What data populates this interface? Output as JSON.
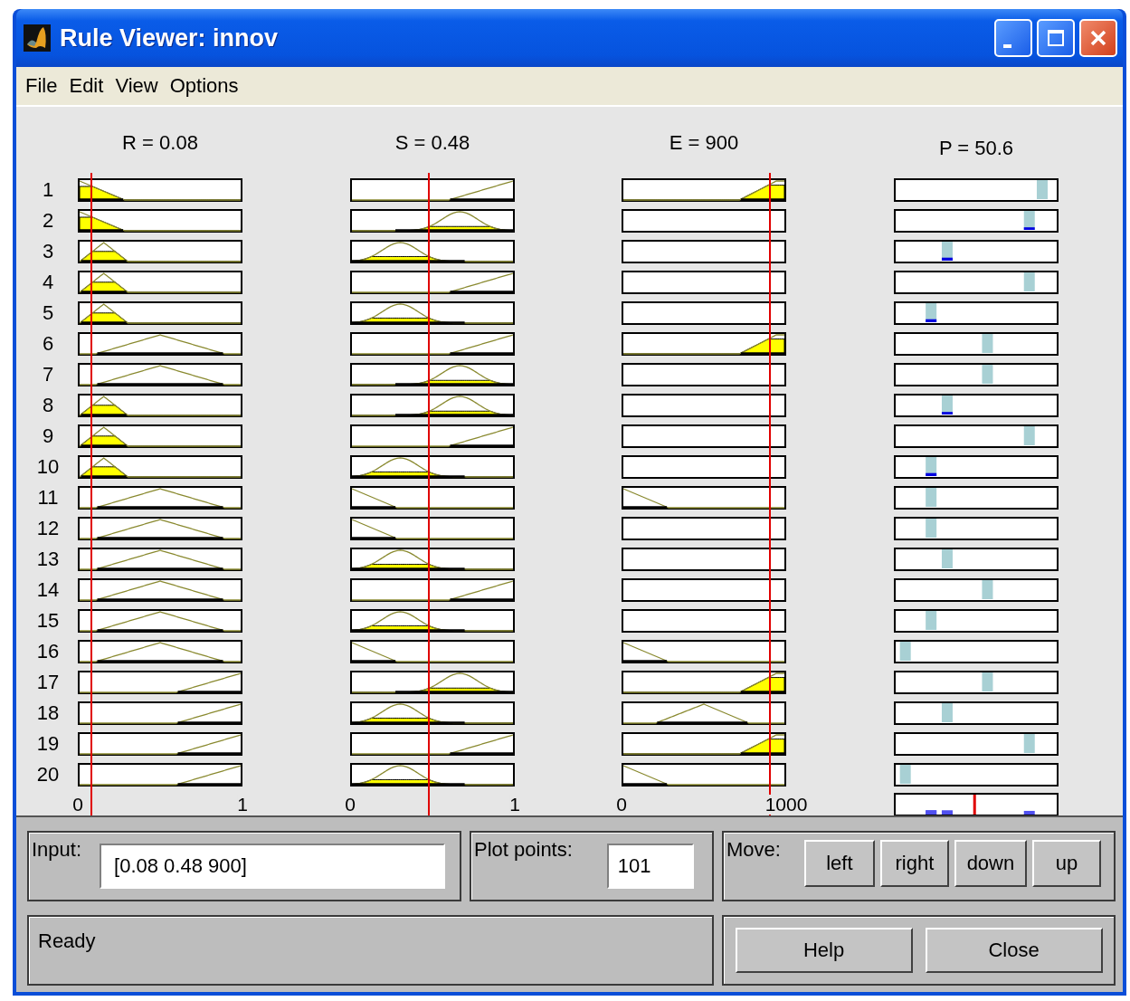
{
  "window": {
    "title": "Rule Viewer: innov"
  },
  "menu": [
    "File",
    "Edit",
    "View",
    "Options"
  ],
  "inputs": [
    {
      "label": "R = 0.08",
      "ticks": [
        "0",
        "1"
      ]
    },
    {
      "label": "S = 0.48",
      "ticks": [
        "0",
        "1"
      ]
    },
    {
      "label": "E = 900",
      "ticks": [
        "0",
        "1000"
      ]
    }
  ],
  "output": {
    "label": "P = 50.6",
    "aggregate": {
      "level": 0.49
    }
  },
  "rules": [
    {
      "number": "1",
      "mfs": [
        {
          "kind": "low-ramp"
        },
        {
          "kind": "high-ramp"
        },
        {
          "kind": "edge-ramp"
        }
      ],
      "output": {
        "level": 0.91
      }
    },
    {
      "number": "2",
      "mfs": [
        {
          "kind": "low-ramp"
        },
        {
          "kind": "high-bell"
        },
        {
          "kind": "empty"
        }
      ],
      "output": {
        "level": 0.83
      }
    },
    {
      "number": "3",
      "mfs": [
        {
          "kind": "narrow-peak"
        },
        {
          "kind": "low-bell"
        },
        {
          "kind": "empty"
        }
      ],
      "output": {
        "level": 0.32
      }
    },
    {
      "number": "4",
      "mfs": [
        {
          "kind": "narrow-peak"
        },
        {
          "kind": "high-ramp"
        },
        {
          "kind": "empty"
        }
      ],
      "output": {
        "level": 0.83
      }
    },
    {
      "number": "5",
      "mfs": [
        {
          "kind": "narrow-peak"
        },
        {
          "kind": "low-bell"
        },
        {
          "kind": "empty"
        }
      ],
      "output": {
        "level": 0.22
      }
    },
    {
      "number": "6",
      "mfs": [
        {
          "kind": "wide-peak"
        },
        {
          "kind": "high-ramp"
        },
        {
          "kind": "edge-ramp"
        }
      ],
      "output": {
        "level": 0.57
      }
    },
    {
      "number": "7",
      "mfs": [
        {
          "kind": "wide-peak"
        },
        {
          "kind": "high-bell"
        },
        {
          "kind": "empty"
        }
      ],
      "output": {
        "level": 0.57
      }
    },
    {
      "number": "8",
      "mfs": [
        {
          "kind": "narrow-peak"
        },
        {
          "kind": "high-bell"
        },
        {
          "kind": "empty"
        }
      ],
      "output": {
        "level": 0.32
      }
    },
    {
      "number": "9",
      "mfs": [
        {
          "kind": "narrow-peak"
        },
        {
          "kind": "high-ramp"
        },
        {
          "kind": "empty"
        }
      ],
      "output": {
        "level": 0.83
      }
    },
    {
      "number": "10",
      "mfs": [
        {
          "kind": "narrow-peak"
        },
        {
          "kind": "low-bell"
        },
        {
          "kind": "empty"
        }
      ],
      "output": {
        "level": 0.22
      }
    },
    {
      "number": "11",
      "mfs": [
        {
          "kind": "wide-peak"
        },
        {
          "kind": "low-ramp"
        },
        {
          "kind": "low-ramp"
        }
      ],
      "output": {
        "level": 0.22
      }
    },
    {
      "number": "12",
      "mfs": [
        {
          "kind": "wide-peak"
        },
        {
          "kind": "low-ramp"
        },
        {
          "kind": "empty"
        }
      ],
      "output": {
        "level": 0.22
      }
    },
    {
      "number": "13",
      "mfs": [
        {
          "kind": "wide-peak"
        },
        {
          "kind": "low-bell"
        },
        {
          "kind": "empty"
        }
      ],
      "output": {
        "level": 0.32
      }
    },
    {
      "number": "14",
      "mfs": [
        {
          "kind": "wide-peak"
        },
        {
          "kind": "high-ramp"
        },
        {
          "kind": "empty"
        }
      ],
      "output": {
        "level": 0.57
      }
    },
    {
      "number": "15",
      "mfs": [
        {
          "kind": "wide-peak"
        },
        {
          "kind": "low-bell"
        },
        {
          "kind": "empty"
        }
      ],
      "output": {
        "level": 0.22
      }
    },
    {
      "number": "16",
      "mfs": [
        {
          "kind": "wide-peak"
        },
        {
          "kind": "low-ramp"
        },
        {
          "kind": "low-ramp"
        }
      ],
      "output": {
        "level": 0.06
      }
    },
    {
      "number": "17",
      "mfs": [
        {
          "kind": "high-ramp"
        },
        {
          "kind": "high-bell"
        },
        {
          "kind": "edge-ramp"
        }
      ],
      "output": {
        "level": 0.57
      }
    },
    {
      "number": "18",
      "mfs": [
        {
          "kind": "high-ramp"
        },
        {
          "kind": "low-bell"
        },
        {
          "kind": "mid-peak"
        }
      ],
      "output": {
        "level": 0.32
      }
    },
    {
      "number": "19",
      "mfs": [
        {
          "kind": "high-ramp"
        },
        {
          "kind": "high-ramp"
        },
        {
          "kind": "edge-ramp"
        }
      ],
      "output": {
        "level": 0.83
      }
    },
    {
      "number": "20",
      "mfs": [
        {
          "kind": "high-ramp"
        },
        {
          "kind": "low-bell"
        },
        {
          "kind": "low-ramp"
        }
      ],
      "output": {
        "level": 0.06
      }
    }
  ],
  "input_field": {
    "label": "Input:",
    "value": "[0.08 0.48 900]"
  },
  "plot_points": {
    "label": "Plot points:",
    "value": "101"
  },
  "move": {
    "label": "Move:",
    "buttons": [
      "left",
      "right",
      "down",
      "up"
    ]
  },
  "status": "Ready",
  "buttons": [
    "Help",
    "Close"
  ]
}
